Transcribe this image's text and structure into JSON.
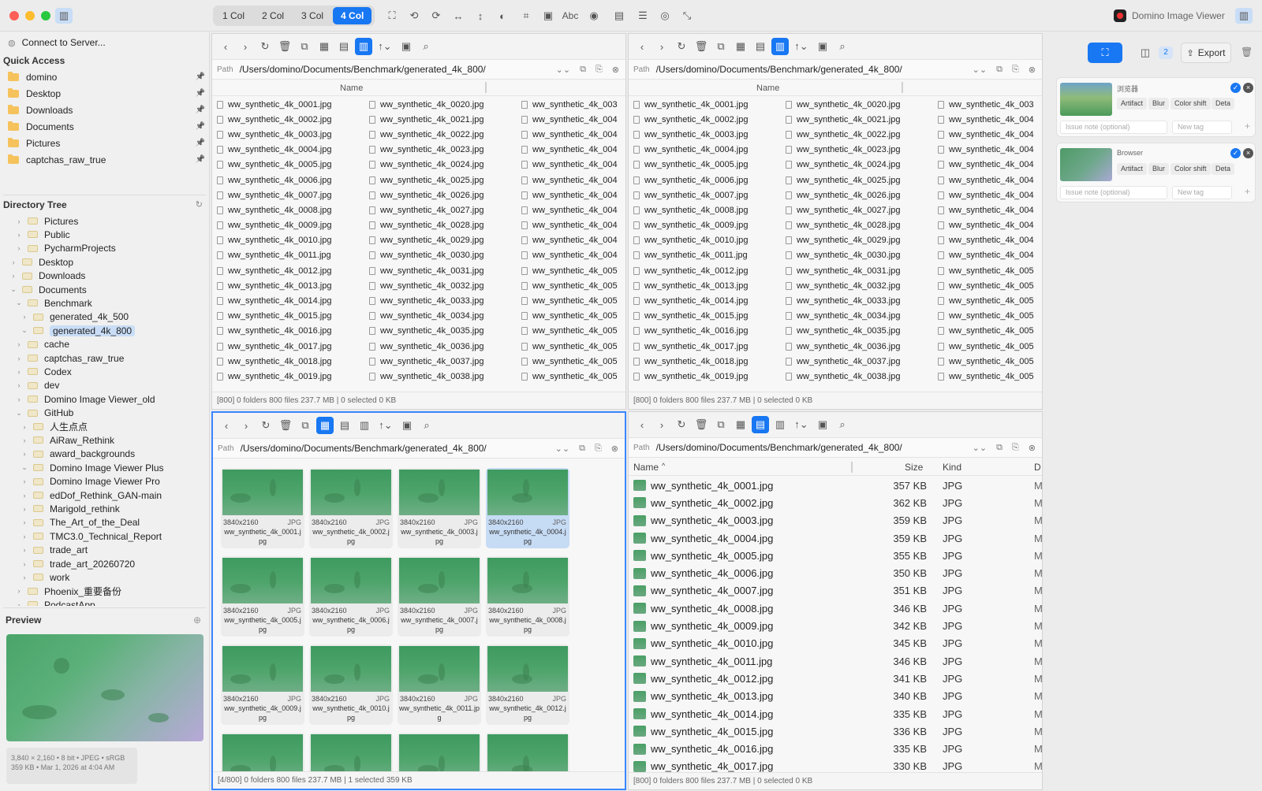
{
  "toolbar": {
    "col_buttons": [
      "1 Col",
      "2 Col",
      "3 Col",
      "4 Col"
    ],
    "active_col": "4 Col",
    "abc_label": "Abc",
    "app_name": "Domino Image Viewer"
  },
  "sidebar": {
    "connect_label": "Connect to Server...",
    "quick_access_title": "Quick Access",
    "quick_access": [
      "domino",
      "Desktop",
      "Downloads",
      "Documents",
      "Pictures",
      "captchas_raw_true"
    ],
    "tree_title": "Directory Tree",
    "tree": [
      {
        "label": "Pictures",
        "level": 1,
        "expanded": false
      },
      {
        "label": "Public",
        "level": 1,
        "expanded": false
      },
      {
        "label": "PycharmProjects",
        "level": 1,
        "expanded": false
      },
      {
        "label": "Desktop",
        "level": 0,
        "expanded": false
      },
      {
        "label": "Downloads",
        "level": 0,
        "expanded": false
      },
      {
        "label": "Documents",
        "level": 0,
        "expanded": true
      },
      {
        "label": "Benchmark",
        "level": 1,
        "expanded": true
      },
      {
        "label": "generated_4k_500",
        "level": 2,
        "expanded": false
      },
      {
        "label": "generated_4k_800",
        "level": 2,
        "expanded": true,
        "selected": true
      },
      {
        "label": "cache",
        "level": 1,
        "expanded": false
      },
      {
        "label": "captchas_raw_true",
        "level": 1,
        "expanded": false
      },
      {
        "label": "Codex",
        "level": 1,
        "expanded": false
      },
      {
        "label": "dev",
        "level": 1,
        "expanded": false
      },
      {
        "label": "Domino Image Viewer_old",
        "level": 1,
        "expanded": false
      },
      {
        "label": "GitHub",
        "level": 1,
        "expanded": true
      },
      {
        "label": "人生点点",
        "level": 2,
        "expanded": false
      },
      {
        "label": "AiRaw_Rethink",
        "level": 2,
        "expanded": false
      },
      {
        "label": "award_backgrounds",
        "level": 2,
        "expanded": false
      },
      {
        "label": "Domino Image Viewer Plus",
        "level": 2,
        "expanded": true
      },
      {
        "label": "Domino Image Viewer Pro",
        "level": 2,
        "expanded": false
      },
      {
        "label": "edDof_Rethink_GAN-main",
        "level": 2,
        "expanded": false
      },
      {
        "label": "Marigold_rethink",
        "level": 2,
        "expanded": false
      },
      {
        "label": "The_Art_of_the_Deal",
        "level": 2,
        "expanded": false
      },
      {
        "label": "TMC3.0_Technical_Report",
        "level": 2,
        "expanded": false
      },
      {
        "label": "trade_art",
        "level": 2,
        "expanded": false
      },
      {
        "label": "trade_art_20260720",
        "level": 2,
        "expanded": false
      },
      {
        "label": "work",
        "level": 2,
        "expanded": false
      },
      {
        "label": "Phoenix_重要备份",
        "level": 1,
        "expanded": false
      },
      {
        "label": "PodcastApp",
        "level": 1,
        "expanded": false
      }
    ],
    "preview_title": "Preview",
    "preview_meta1": "3,840 × 2,160 • 8 bit • JPEG • sRGB",
    "preview_meta2": "359 KB • Mar 1, 2026 at 4:04 AM"
  },
  "panes": {
    "path_label": "Path",
    "path_value": "/Users/domino/Documents/Benchmark/generated_4k_800/",
    "name_header": "Name",
    "list_col1": [
      "ww_synthetic_4k_0001.jpg",
      "ww_synthetic_4k_0002.jpg",
      "ww_synthetic_4k_0003.jpg",
      "ww_synthetic_4k_0004.jpg",
      "ww_synthetic_4k_0005.jpg",
      "ww_synthetic_4k_0006.jpg",
      "ww_synthetic_4k_0007.jpg",
      "ww_synthetic_4k_0008.jpg",
      "ww_synthetic_4k_0009.jpg",
      "ww_synthetic_4k_0010.jpg",
      "ww_synthetic_4k_0011.jpg",
      "ww_synthetic_4k_0012.jpg",
      "ww_synthetic_4k_0013.jpg",
      "ww_synthetic_4k_0014.jpg",
      "ww_synthetic_4k_0015.jpg",
      "ww_synthetic_4k_0016.jpg",
      "ww_synthetic_4k_0017.jpg",
      "ww_synthetic_4k_0018.jpg",
      "ww_synthetic_4k_0019.jpg"
    ],
    "list_col2": [
      "ww_synthetic_4k_0020.jpg",
      "ww_synthetic_4k_0021.jpg",
      "ww_synthetic_4k_0022.jpg",
      "ww_synthetic_4k_0023.jpg",
      "ww_synthetic_4k_0024.jpg",
      "ww_synthetic_4k_0025.jpg",
      "ww_synthetic_4k_0026.jpg",
      "ww_synthetic_4k_0027.jpg",
      "ww_synthetic_4k_0028.jpg",
      "ww_synthetic_4k_0029.jpg",
      "ww_synthetic_4k_0030.jpg",
      "ww_synthetic_4k_0031.jpg",
      "ww_synthetic_4k_0032.jpg",
      "ww_synthetic_4k_0033.jpg",
      "ww_synthetic_4k_0034.jpg",
      "ww_synthetic_4k_0035.jpg",
      "ww_synthetic_4k_0036.jpg",
      "ww_synthetic_4k_0037.jpg",
      "ww_synthetic_4k_0038.jpg"
    ],
    "list_col3": [
      "ww_synthetic_4k_003",
      "ww_synthetic_4k_004",
      "ww_synthetic_4k_004",
      "ww_synthetic_4k_004",
      "ww_synthetic_4k_004",
      "ww_synthetic_4k_004",
      "ww_synthetic_4k_004",
      "ww_synthetic_4k_004",
      "ww_synthetic_4k_004",
      "ww_synthetic_4k_004",
      "ww_synthetic_4k_004",
      "ww_synthetic_4k_005",
      "ww_synthetic_4k_005",
      "ww_synthetic_4k_005",
      "ww_synthetic_4k_005",
      "ww_synthetic_4k_005",
      "ww_synthetic_4k_005",
      "ww_synthetic_4k_005",
      "ww_synthetic_4k_005"
    ],
    "status_top": "[800]   0 folders   800 files   237.7 MB   |   0 selected   0 KB",
    "status_grid": "[4/800]   0 folders   800 files   237.7 MB   |   1 selected   359 KB",
    "status_detail": "[800]   0 folders   800 files   237.7 MB   |   0 selected   0 KB",
    "thumbs": [
      {
        "dim": "3840x2160",
        "ext": "JPG",
        "name": "ww_synthetic_4k_0001.jpg"
      },
      {
        "dim": "3840x2160",
        "ext": "JPG",
        "name": "ww_synthetic_4k_0002.jpg"
      },
      {
        "dim": "3840x2160",
        "ext": "JPG",
        "name": "ww_synthetic_4k_0003.jpg"
      },
      {
        "dim": "3840x2160",
        "ext": "JPG",
        "name": "ww_synthetic_4k_0004.jpg",
        "selected": true
      },
      {
        "dim": "3840x2160",
        "ext": "JPG",
        "name": "ww_synthetic_4k_0005.jpg"
      },
      {
        "dim": "3840x2160",
        "ext": "JPG",
        "name": "ww_synthetic_4k_0006.jpg"
      },
      {
        "dim": "3840x2160",
        "ext": "JPG",
        "name": "ww_synthetic_4k_0007.jpg"
      },
      {
        "dim": "3840x2160",
        "ext": "JPG",
        "name": "ww_synthetic_4k_0008.jpg"
      },
      {
        "dim": "3840x2160",
        "ext": "JPG",
        "name": "ww_synthetic_4k_0009.jpg"
      },
      {
        "dim": "3840x2160",
        "ext": "JPG",
        "name": "ww_synthetic_4k_0010.jpg"
      },
      {
        "dim": "3840x2160",
        "ext": "JPG",
        "name": "ww_synthetic_4k_0011.jpg"
      },
      {
        "dim": "3840x2160",
        "ext": "JPG",
        "name": "ww_synthetic_4k_0012.jpg"
      },
      {
        "dim": "",
        "ext": "",
        "name": ""
      },
      {
        "dim": "",
        "ext": "",
        "name": ""
      },
      {
        "dim": "",
        "ext": "",
        "name": ""
      },
      {
        "dim": "",
        "ext": "",
        "name": ""
      }
    ],
    "detail_headers": {
      "name": "Name",
      "size": "Size",
      "kind": "Kind",
      "date": "D"
    },
    "detail_rows": [
      {
        "name": "ww_synthetic_4k_0001.jpg",
        "size": "357 KB",
        "kind": "JPG",
        "d": "M"
      },
      {
        "name": "ww_synthetic_4k_0002.jpg",
        "size": "362 KB",
        "kind": "JPG",
        "d": "M"
      },
      {
        "name": "ww_synthetic_4k_0003.jpg",
        "size": "359 KB",
        "kind": "JPG",
        "d": "M"
      },
      {
        "name": "ww_synthetic_4k_0004.jpg",
        "size": "359 KB",
        "kind": "JPG",
        "d": "M"
      },
      {
        "name": "ww_synthetic_4k_0005.jpg",
        "size": "355 KB",
        "kind": "JPG",
        "d": "M"
      },
      {
        "name": "ww_synthetic_4k_0006.jpg",
        "size": "350 KB",
        "kind": "JPG",
        "d": "M"
      },
      {
        "name": "ww_synthetic_4k_0007.jpg",
        "size": "351 KB",
        "kind": "JPG",
        "d": "M"
      },
      {
        "name": "ww_synthetic_4k_0008.jpg",
        "size": "346 KB",
        "kind": "JPG",
        "d": "M"
      },
      {
        "name": "ww_synthetic_4k_0009.jpg",
        "size": "342 KB",
        "kind": "JPG",
        "d": "M"
      },
      {
        "name": "ww_synthetic_4k_0010.jpg",
        "size": "345 KB",
        "kind": "JPG",
        "d": "M"
      },
      {
        "name": "ww_synthetic_4k_0011.jpg",
        "size": "346 KB",
        "kind": "JPG",
        "d": "M"
      },
      {
        "name": "ww_synthetic_4k_0012.jpg",
        "size": "341 KB",
        "kind": "JPG",
        "d": "M"
      },
      {
        "name": "ww_synthetic_4k_0013.jpg",
        "size": "340 KB",
        "kind": "JPG",
        "d": "M"
      },
      {
        "name": "ww_synthetic_4k_0014.jpg",
        "size": "335 KB",
        "kind": "JPG",
        "d": "M"
      },
      {
        "name": "ww_synthetic_4k_0015.jpg",
        "size": "336 KB",
        "kind": "JPG",
        "d": "M"
      },
      {
        "name": "ww_synthetic_4k_0016.jpg",
        "size": "335 KB",
        "kind": "JPG",
        "d": "M"
      },
      {
        "name": "ww_synthetic_4k_0017.jpg",
        "size": "330 KB",
        "kind": "JPG",
        "d": "M"
      }
    ]
  },
  "right_panel": {
    "count_badge": "2",
    "export_label": "Export",
    "cards": [
      {
        "title": "浏览器",
        "tags": [
          "Artifact",
          "Blur",
          "Color shift",
          "Deta"
        ],
        "note_placeholder": "Issue note (optional)",
        "tag_placeholder": "New tag"
      },
      {
        "title": "Browser",
        "tags": [
          "Artifact",
          "Blur",
          "Color shift",
          "Deta"
        ],
        "note_placeholder": "Issue note (optional)",
        "tag_placeholder": "New tag"
      }
    ]
  }
}
